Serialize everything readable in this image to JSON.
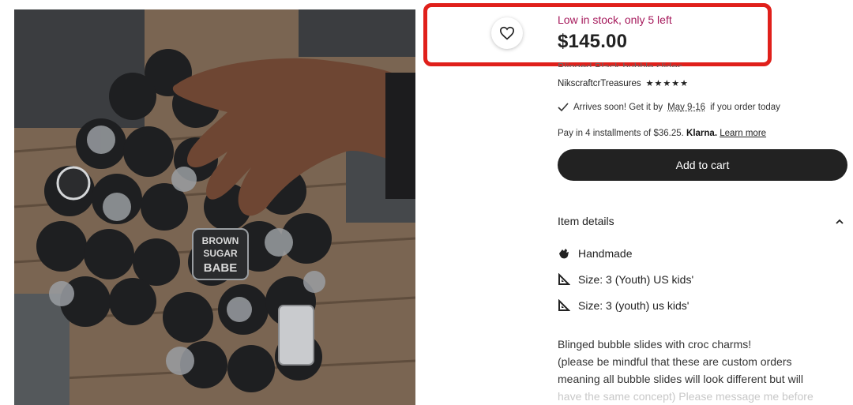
{
  "product": {
    "stock_text": "Low in stock, only 5 left",
    "price": "$145.00",
    "title_partial": "Blinged Black bubble slides",
    "seller": "NikscraftcrTreasures",
    "stars": "★★★★★",
    "arrives_prefix": "Arrives soon! Get it by",
    "arrives_dates": "May 9-16",
    "arrives_suffix": "if you order today",
    "pay_text": "Pay in 4 installments of $36.25.",
    "pay_provider": "Klarna.",
    "learn_more": "Learn more",
    "add_to_cart": "Add to cart"
  },
  "details": {
    "header": "Item details",
    "rows": [
      "Handmade",
      "Size: 3 (Youth) US kids'",
      "Size: 3 (youth) us kids'"
    ],
    "description_lines": [
      "Blinged bubble slides with croc charms!",
      "(please be mindful that these are custom orders",
      "meaning all bubble slides will look different but will",
      "have the same concept) Please message me before"
    ]
  },
  "photo": {
    "charm_text_1": "BROWN",
    "charm_text_2": "SUGAR",
    "charm_text_3": "BABE"
  },
  "icons": {
    "favorite": "heart-outline-icon",
    "arrives": "checkmark-icon",
    "details_toggle": "chevron-up-icon",
    "handmade": "hand-wave-icon",
    "size": "ruler-triangle-icon"
  },
  "colors": {
    "stock": "#a61a5c",
    "highlight_border": "#e0201b",
    "cart_button": "#222222"
  }
}
